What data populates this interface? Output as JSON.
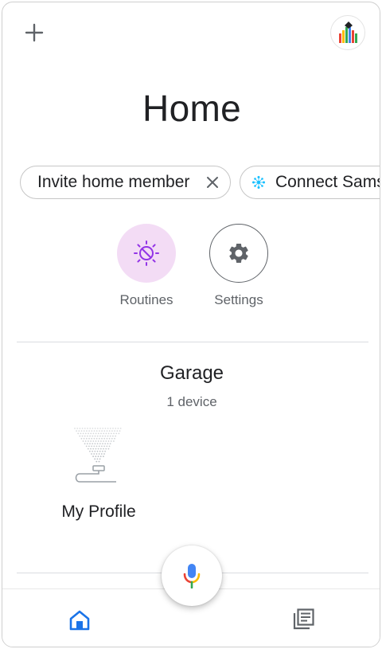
{
  "header": {
    "add_icon": "plus-icon",
    "avatar_icon": "home-avatar-icon",
    "title": "Home"
  },
  "chips": [
    {
      "label": "Invite home member",
      "trailing_icon": "close-icon"
    },
    {
      "label": "Connect Sams",
      "leading_icon": "smartthings-icon"
    }
  ],
  "actions": {
    "routines": {
      "label": "Routines",
      "icon": "routines-icon",
      "color": "#9334e6",
      "bg": "#f3dcf5"
    },
    "settings": {
      "label": "Settings",
      "icon": "gear-icon"
    }
  },
  "room": {
    "name": "Garage",
    "device_count": "1 device",
    "devices": [
      {
        "label": "My Profile",
        "icon": "light-device-icon"
      }
    ]
  },
  "mic": {
    "icon": "mic-icon",
    "colors": [
      "#4285f4",
      "#ea4335",
      "#fbbc04",
      "#34a853"
    ]
  },
  "nav": {
    "home_icon": "home-icon",
    "feed_icon": "feed-icon",
    "active_color": "#1a73e8"
  }
}
